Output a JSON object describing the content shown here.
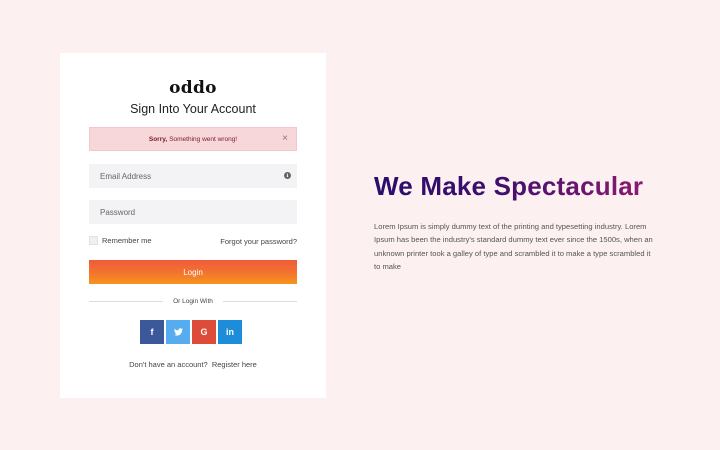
{
  "card": {
    "brand": "oddo",
    "title": "Sign Into Your Account",
    "alert": {
      "strong": "Sorry,",
      "message": "Something went wrong!",
      "close": "×"
    },
    "email_placeholder": "Email Address",
    "password_placeholder": "Password",
    "info_icon": "i",
    "remember_label": "Remember me",
    "forgot_label": "Forgot your password?",
    "login_label": "Login",
    "divider_label": "Or Login With",
    "socials": [
      {
        "name": "facebook",
        "glyph": "f"
      },
      {
        "name": "twitter",
        "glyph": "t"
      },
      {
        "name": "google",
        "glyph": "G"
      },
      {
        "name": "linkedin",
        "glyph": "in"
      }
    ],
    "signup_prompt": "Don't have an account?",
    "signup_link": "Register here"
  },
  "hero": {
    "headline": "We Make Spectacular",
    "body": "Lorem Ipsum is simply dummy text of the printing and typesetting industry. Lorem Ipsum has been the industry's standard dummy text ever since the 1500s, when an unknown printer took a galley of type and scrambled it to make a type scrambled it to make"
  },
  "colors": {
    "page_bg": "#fdf0f0",
    "alert_bg": "#f8d7da",
    "login_gradient_start": "#f05a3c",
    "login_gradient_end": "#f7941d",
    "facebook": "#3b5998",
    "twitter": "#55acee",
    "google": "#dd4b39",
    "linkedin": "#1d8dd9",
    "headline_start": "#2a0d6b",
    "headline_end": "#8b1a70"
  }
}
